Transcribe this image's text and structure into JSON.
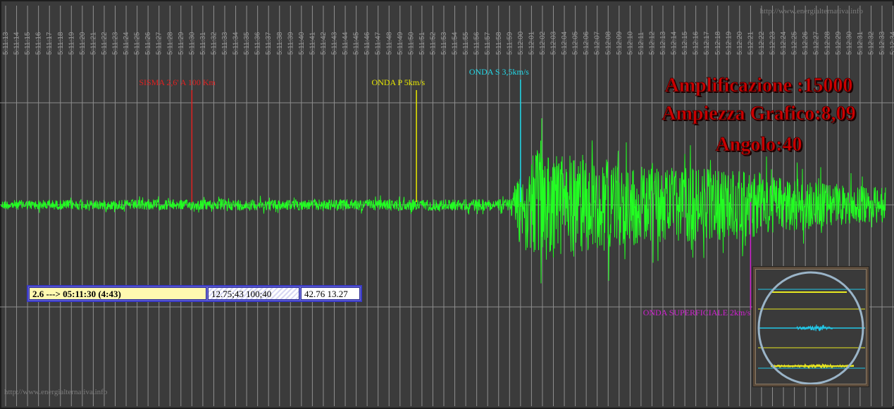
{
  "watermark_top": "http://www.energialternativa.info",
  "watermark_bottom": "http://www.energialternativa.info",
  "chart_data": {
    "type": "line",
    "time_labels": [
      "5:11:13",
      "5:11:14",
      "5:11:15",
      "5:11:16",
      "5:11:17",
      "5:11:18",
      "5:11:19",
      "5:11:20",
      "5:11:21",
      "5:11:22",
      "5:11:23",
      "5:11:24",
      "5:11:25",
      "5:11:26",
      "5:11:27",
      "5:11:28",
      "5:11:29",
      "5:11:30",
      "5:11:31",
      "5:11:32",
      "5:11:33",
      "5:11:34",
      "5:11:35",
      "5:11:36",
      "5:11:37",
      "5:11:38",
      "5:11:39",
      "5:11:40",
      "5:11:41",
      "5:11:42",
      "5:11:43",
      "5:11:44",
      "5:11:45",
      "5:11:46",
      "5:11:47",
      "5:11:48",
      "5:11:49",
      "5:11:50",
      "5:11:51",
      "5:11:52",
      "5:11:53",
      "5:11:54",
      "5:11:55",
      "5:11:56",
      "5:11:57",
      "5:11:58",
      "5:11:59",
      "5:12:00",
      "5:12:01",
      "5:12:02",
      "5:12:03",
      "5:12:04",
      "5:12:05",
      "5:12:06",
      "5:12:07",
      "5:12:08",
      "5:12:09",
      "5:12:10",
      "5:12:11",
      "5:12:12",
      "5:12:13",
      "5:12:14",
      "5:12:15",
      "5:12:16",
      "5:12:17",
      "5:12:18",
      "5:12:19",
      "5:12:20",
      "5:12:21",
      "5:12:22",
      "5:12:23",
      "5:12:24",
      "5:12:25",
      "5:12:26",
      "5:12:27",
      "5:12:28",
      "5:12:29",
      "5:12:30",
      "5:12:31",
      "5:12:32",
      "5:12:33",
      "5:12:34",
      "5:12:35",
      "5:12:36",
      "5:12:37"
    ],
    "time_range": [
      "5:11:13",
      "5:12:37"
    ],
    "markers": [
      {
        "label": "SISMA 2,6' A 100 Km",
        "time": "5:11:30.0",
        "color": "#e02020"
      },
      {
        "label": "ONDA P 5km/s",
        "time": "5:11:50.5",
        "color": "#e8e800"
      },
      {
        "label": "ONDA S 3,5km/s",
        "time": "5:12:00.0",
        "color": "#20d8e8"
      },
      {
        "label": "ONDA SUPERFICIALE 2km/s",
        "time": "5:12:21.0",
        "color": "#d020d0"
      }
    ],
    "annotations": [
      "Amplificazione :15000",
      "Ampiezza Grafico:8,09",
      "Angolo:40"
    ],
    "signal_envelope": [
      {
        "time": "5:11:13",
        "amplitude": 0.05
      },
      {
        "time": "5:11:59",
        "amplitude": 0.06
      },
      {
        "time": "5:12:00",
        "amplitude": 0.45
      },
      {
        "time": "5:12:02",
        "amplitude": 0.6
      },
      {
        "time": "5:12:10",
        "amplitude": 0.42
      },
      {
        "time": "5:12:20",
        "amplitude": 0.35
      },
      {
        "time": "5:12:30",
        "amplitude": 0.2
      },
      {
        "time": "5:12:37",
        "amplitude": 0.17
      }
    ],
    "grid": true,
    "trace_color": "#22ff22"
  },
  "info_panel": {
    "event": "2.6 ---> 05:11:30 (4:43)",
    "coords": "12.75;43 100;40",
    "location": "42.76 13.27"
  },
  "colors": {
    "background": "#3b3b3b",
    "grid": "#8e8e8e",
    "tick_label": "#9a9a9a",
    "annotation": "#cc0000",
    "scope_cyan": "#22c8e8",
    "scope_yellow": "#e8e820"
  }
}
